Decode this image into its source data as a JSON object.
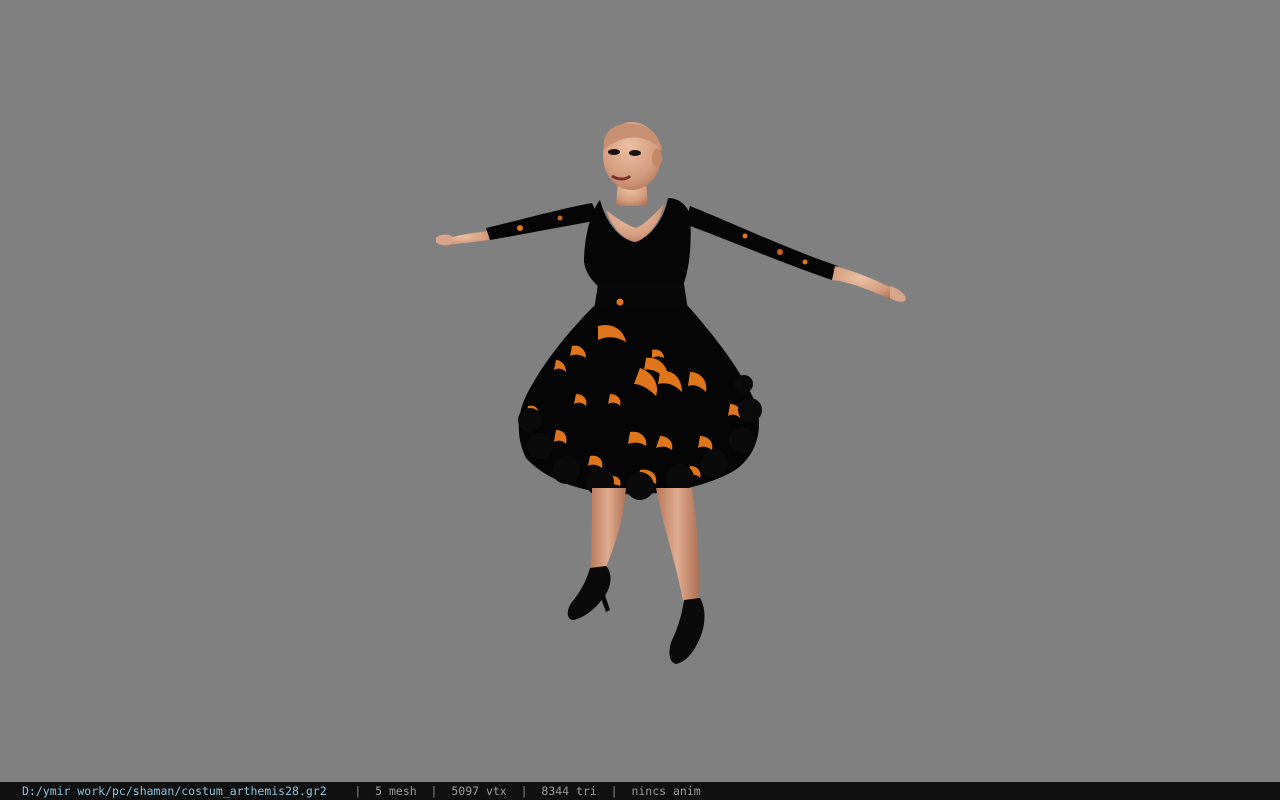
{
  "status_bar": {
    "file_path": "D:/ymir work/pc/shaman/costum_arthemis28.gr2",
    "separator": "|",
    "mesh_count": "5 mesh",
    "vertex_count": "5097 vtx",
    "triangle_count": "8344 tri",
    "animation": "nincs anim"
  },
  "colors": {
    "viewport_background": "#808080",
    "status_bar_background": "#101010",
    "path_text": "#8fc0d8",
    "stat_text": "#9a9a9a",
    "dress": "#050505",
    "dress_pattern": "#e0761c",
    "skin": "#d9a58a"
  },
  "icons": {
    "model": "character-model-3d"
  }
}
